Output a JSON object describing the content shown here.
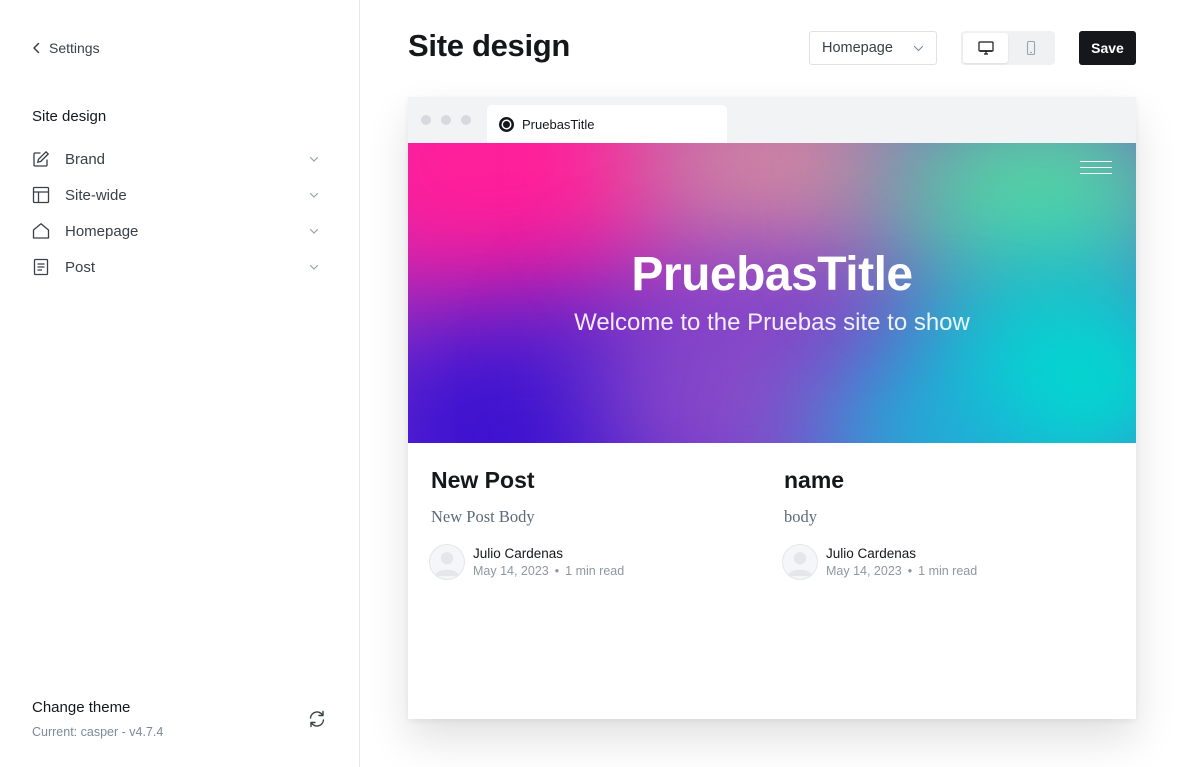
{
  "sidebar": {
    "back_label": "Settings",
    "section_title": "Site design",
    "items": [
      {
        "label": "Brand",
        "icon": "pencil-square-icon"
      },
      {
        "label": "Site-wide",
        "icon": "layout-icon"
      },
      {
        "label": "Homepage",
        "icon": "home-icon"
      },
      {
        "label": "Post",
        "icon": "document-icon"
      }
    ],
    "theme": {
      "title": "Change theme",
      "current": "Current: casper - v4.7.4"
    }
  },
  "header": {
    "title": "Site design",
    "page_select": "Homepage",
    "save_label": "Save"
  },
  "preview": {
    "tab_title": "PruebasTitle",
    "hero_title": "PruebasTitle",
    "hero_subtitle": "Welcome to the Pruebas site to show",
    "posts": [
      {
        "title": "New Post",
        "excerpt": "New Post Body",
        "author": "Julio Cardenas",
        "date": "May 14, 2023",
        "read_time": "1 min read"
      },
      {
        "title": "name",
        "excerpt": "body",
        "author": "Julio Cardenas",
        "date": "May 14, 2023",
        "read_time": "1 min read"
      }
    ]
  },
  "colors": {
    "primary_button": "#15171a",
    "hero_pink": "#ff1f9a",
    "hero_purple": "#3a10d0",
    "hero_teal": "#00dcd0"
  }
}
